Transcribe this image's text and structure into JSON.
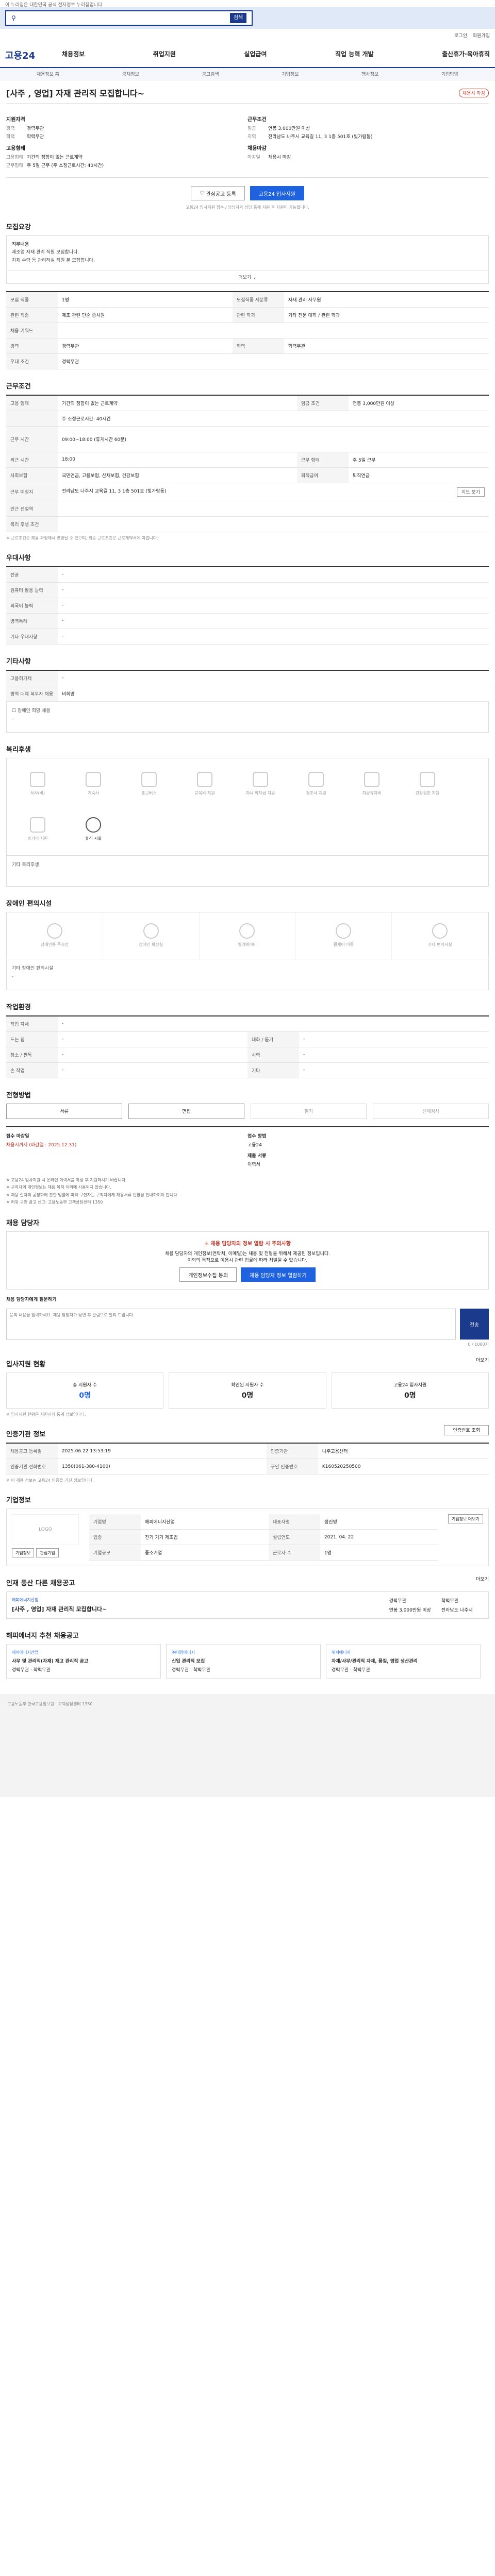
{
  "top": {
    "notice": "이 누리집은 대한민국 공식 전자정부 누리집입니다."
  },
  "search": {
    "placeholder": "",
    "button": "검색"
  },
  "header": {
    "util": [
      "로그인",
      "회원가입"
    ],
    "logo": "고용24",
    "gnb": [
      "채용정보",
      "취업지원",
      "실업급여",
      "직업 능력 개발",
      "출산휴가·육아휴직"
    ]
  },
  "subnav": [
    "채용정보 홈",
    "공채정보",
    "공고검색",
    "기업정보",
    "행사정보",
    "기업탐방"
  ],
  "job": {
    "title": "[사주 , 영업] 자재 관리직 모집합니다~",
    "badge": "채용시 마감",
    "summary_left": {
      "h1": "지원자격",
      "r1k": "경력",
      "r1v": "경력무관",
      "r2k": "학력",
      "r2v": "학력무관",
      "h2": "고용형태",
      "r3k": "고용형태",
      "r3v": "기간의 정함이 없는 근로계약",
      "r4k": "근무형태",
      "r4v": "주 5일 근무 (주 소정근로시간: 40시간)"
    },
    "summary_right": {
      "h1": "근무조건",
      "r1k": "임금",
      "r1v": "연봉 3,000만원 이상",
      "r2k": "지역",
      "r2v": "전라남도 나주시 교육길 11, 3 1층 501호 (빛가람동)",
      "h2": "채용마감",
      "r3k": "마감일",
      "r3v": "채용시 마감"
    },
    "btn_save": "관심공고 등록",
    "btn_apply": "고용24 입사지원",
    "small_notice": "고용24 입사지원 접수 / 담당자와 상담 통해 지원 후 지원이 가능합니다."
  },
  "recruit": {
    "title": "모집요강",
    "body": [
      "직무내용",
      "제조업 자재 관리 직원 모집합니다.",
      "자재 수량 등 관리하실 직원 분 모집합니다."
    ],
    "more": "더보기",
    "rows": [
      [
        "모집 직종",
        "1명",
        "모집직종 세분류",
        "자재 관리 사무원"
      ],
      [
        "관련 직종",
        "제조 관련 단순 종사원",
        "관련 학과",
        "기타 전문 대학 / 관련 학과"
      ],
      [
        "채용 키워드",
        ""
      ],
      [
        "경력",
        "경력무관",
        "학력",
        "학력무관"
      ],
      [
        "우대 조건",
        "경력무관"
      ]
    ]
  },
  "work": {
    "title": "근무조건",
    "rows": [
      [
        "고용 형태",
        "기간의 정함이 없는 근로계약",
        "임금 조건",
        "연봉 3,000만원 이상"
      ],
      [
        "",
        "주 소정근로시간: 40시간"
      ],
      [
        "근무 시간",
        "09:00~18:00 (휴게시간 60분)",
        "",
        ""
      ],
      [
        "퇴근 시간",
        "18:00",
        "근무 형태",
        "주 5일 근무"
      ],
      [
        "사회보험",
        "국민연금, 고용보험, 산재보험, 건강보험",
        "퇴직급여",
        "퇴직연금"
      ],
      [
        "근무 예정지",
        "전라남도 나주시 교육길 11, 3 1층 501호 (빛가람동)",
        "",
        ""
      ],
      [
        "인근 전철역",
        ""
      ],
      [
        "복리 후생 조건",
        ""
      ]
    ],
    "note": "※ 근로조건은 채용 과정에서 변경될 수 있으며, 최종 근로조건은 근로계약서에 따릅니다.",
    "map_btn": "지도 보기"
  },
  "prefer": {
    "title": "우대사항",
    "rows": [
      [
        "전공",
        "-"
      ],
      [
        "컴퓨터 활용 능력",
        "-"
      ],
      [
        "외국어 능력",
        "-"
      ],
      [
        "병역특례",
        "-"
      ],
      [
        "기타 우대사항",
        "-"
      ]
    ]
  },
  "etc": {
    "title": "기타사항",
    "rows": [
      [
        "고용허가제",
        "-"
      ],
      [
        "병역 대체 복무자 채용",
        "비희망"
      ]
    ],
    "dis_label": "장애인 희망 채용",
    "dis_value": "-"
  },
  "welfare": {
    "title": "복리후생",
    "items": [
      "식사(비)",
      "기숙사",
      "통근버스",
      "교육비 지원",
      "자녀 학자금 지원",
      "경조사 지원",
      "차량유지비",
      "건강검진 지원",
      "휴가비 지원",
      "휴식 시설"
    ],
    "extra_label": "기타 복리후생"
  },
  "disability": {
    "title": "장애인 편의시설",
    "items": [
      "장애인용 주차장",
      "장애인 화장실",
      "엘리베이터",
      "휠체어 이동",
      "기타 편의시설"
    ],
    "extra_label": "기타 장애인 편의시설",
    "extra_value": "-"
  },
  "environment": {
    "title": "작업환경",
    "rows": [
      [
        "작업 자세",
        "-"
      ],
      [
        "드는 힘",
        "-",
        "대화 / 듣기",
        "-"
      ],
      [
        "청소 / 판독",
        "-",
        "시력",
        "-"
      ],
      [
        "손 작업",
        "-",
        "기타",
        "-"
      ]
    ]
  },
  "process": {
    "title": "전형방법",
    "steps": [
      "서류",
      "면접",
      "필기",
      "신체검사"
    ],
    "recv": {
      "l1": "접수 마감일",
      "v1": "채용시까지 (마감일 : 2025.12.31)",
      "l2": "접수 방법",
      "v2": "고용24",
      "l3": "제출 서류",
      "v3": "이력서"
    },
    "bullets": [
      "※ 고용24 입사지원 시 온라인 이력서를 작성 후 지원하시기 바랍니다.",
      "※ 구직자의 개인정보는 채용 목적 이외에 사용되지 않습니다.",
      "※ 채용 절차의 공정화에 관한 법률에 따라 구인자는 구직자에게 채용서류 반환을 안내하여야 합니다.",
      "※ 허위 구인 광고 신고: 고용노동부 고객상담센터 1350"
    ]
  },
  "contact": {
    "title": "채용 담당자",
    "alert": "채용 담당자의 정보 열람 시 주의사항",
    "desc": "채용 담당자의 개인정보(연락처, 이메일)는 채용 및 전형을 위해서 제공된 정보입니다.",
    "desc2": "이외의 목적으로 이용시 관련 법률에 따라 처벌될 수 있습니다.",
    "b1": "개인정보수집 동의",
    "b2": "채용 담당자 정보 열람하기",
    "qa_label": "채용 담당자에게 질문하기",
    "qa_placeholder": "문의 내용을 입력하세요. 채용 담당자가 답변 후 알림으로 알려 드립니다.",
    "qa_count": "0 / 1000자",
    "send": "전송"
  },
  "apply_stats": {
    "title": "입사지원 현황",
    "link": "더보기",
    "s1l": "총 지원자 수",
    "s1v": "0명",
    "s2l": "확인된 지원자 수",
    "s2v": "0명",
    "s3l": "고용24 입사지원",
    "s3v": "0명",
    "note": "※ 입사지원 현황은 지원자의 통계 정보입니다."
  },
  "info_table": {
    "title": "인증기관 정보",
    "btn": "인증번호 조회",
    "rows": [
      [
        "채용공고 등록일",
        "2025.06.22 13:53:19",
        "인증기관",
        "나주고용센터"
      ],
      [
        "인증기관 전화번호",
        "1350(061-380-4100)",
        "구인 인증번호",
        "K160520250500"
      ]
    ],
    "note": "※ 이 채용 정보는 고용24 인증을 거친 정보입니다."
  },
  "company": {
    "title": "기업정보",
    "logo": "LOGO",
    "b1": "기업정보",
    "b2": "관심기업",
    "rows": [
      [
        "기업명",
        "해피에너지산업",
        "대표자명",
        "정진영"
      ],
      [
        "업종",
        "전기 기기 제조업",
        "설립연도",
        "2021. 04. 22"
      ],
      [
        "기업규모",
        "중소기업",
        "근로자 수",
        "1명"
      ]
    ],
    "link": "기업정보 더보기"
  },
  "related": {
    "title": "인재 풍산 다른 채용공고",
    "link": "더보기",
    "co": "해피에너지산업",
    "ti": "[사주 , 영업] 자재 관리직 모집합니다~",
    "opts": [
      "경력무관",
      "학력무관",
      "연봉 3,000만원 이상",
      "전라남도 나주시"
    ]
  },
  "recommend": {
    "title": "해피에너지 추천 채용공고",
    "cards": [
      {
        "co": "해피에너지산업",
        "ti": "사무 및 관리직(자재) 재고 관리직 공고",
        "tag": "경력무관 · 학력무관"
      },
      {
        "co": "㈜태양에너지",
        "ti": "신입 관리직 모집",
        "tag": "경력무관 · 학력무관"
      },
      {
        "co": "해피에너지",
        "ti": "자재/사무/관리직 자재, 품질, 영업 생산관리",
        "tag": "경력무관 · 학력무관"
      }
    ]
  },
  "footer": {
    "text": "고용노동부 한국고용정보원 · 고객상담센터 1350"
  }
}
